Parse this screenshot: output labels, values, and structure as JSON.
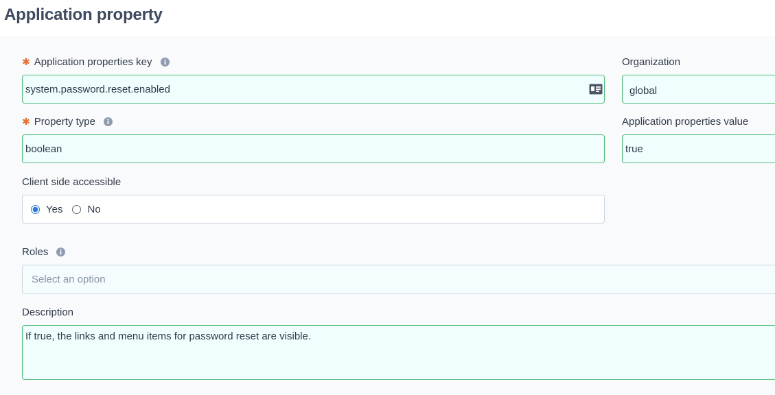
{
  "page": {
    "title": "Application property"
  },
  "form": {
    "key": {
      "label": "Application properties key",
      "value": "system.password.reset.enabled",
      "required": true
    },
    "organization": {
      "label": "Organization",
      "value": "global"
    },
    "property_type": {
      "label": "Property type",
      "value": "boolean",
      "required": true
    },
    "value": {
      "label": "Application properties value",
      "value": "true"
    },
    "client_side": {
      "label": "Client side accessible",
      "options": [
        {
          "label": "Yes",
          "checked": true
        },
        {
          "label": "No",
          "checked": false
        }
      ]
    },
    "roles": {
      "label": "Roles",
      "placeholder": "Select an option"
    },
    "description": {
      "label": "Description",
      "value": "If true, the links and menu items for password reset are visible."
    }
  },
  "colors": {
    "required": "#f26b2d",
    "valid_border": "#4ec07a",
    "field_bg": "#f0fffe",
    "info_icon": "#8e9bb0",
    "radio_accent": "#2c78dc"
  },
  "icons": {
    "info": "info-icon",
    "id_card": "id-card-icon",
    "required": "asterisk-icon"
  }
}
